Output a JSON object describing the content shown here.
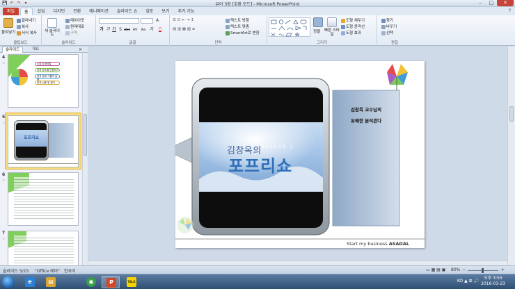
{
  "window": {
    "title": "유아 3장 [호환 모드] - Microsoft PowerPoint",
    "qat": [
      "💾",
      "↶",
      "↷",
      "▾"
    ]
  },
  "tabs": [
    "파일",
    "홈",
    "삽입",
    "디자인",
    "전환",
    "애니메이션",
    "슬라이드 쇼",
    "검토",
    "보기",
    "추가 기능"
  ],
  "help_icon": "?",
  "ribbon": {
    "clipboard": {
      "paste": "붙여넣기",
      "cut": "잘라내기",
      "copy": "복사",
      "format_painter": "서식 복사",
      "name": "클립보드"
    },
    "slides": {
      "new": "새 슬라이드",
      "layout": "레이아웃",
      "reset": "원래대로",
      "section": "구역",
      "name": "슬라이드"
    },
    "font": {
      "name": "글꼴",
      "buttons": [
        "가",
        "가",
        "가",
        "가̲",
        "S",
        "abc",
        "AV",
        "Aa",
        "가",
        "A"
      ]
    },
    "paragraph": {
      "name": "단락",
      "text_dir": "텍스트 방향",
      "align_text": "텍스트 맞춤",
      "smartart": "SmartArt로 변환"
    },
    "drawing": {
      "name": "그리기",
      "arrange": "정렬",
      "quick_styles": "빠른 스타일",
      "fill": "도형 채우기",
      "outline": "도형 윤곽선",
      "effects": "도형 효과"
    },
    "editing": {
      "name": "편집",
      "find": "찾기",
      "replace": "바꾸기",
      "select": "선택"
    }
  },
  "panel": {
    "tab_slides": "슬라이드",
    "tab_outline": "개요",
    "close": "×",
    "slides": [
      {
        "num": "4",
        "star": "☆",
        "items": [
          "스피치 정리법",
          "장과 장소별 반응하기",
          "장과 문제 그룹의 설명",
          "장과 심층 및 평가"
        ]
      },
      {
        "num": "5",
        "star": "☆",
        "logo_small": "포프리쇼"
      },
      {
        "num": "6",
        "star": "☆"
      },
      {
        "num": "7",
        "star": "☆"
      }
    ]
  },
  "slide": {
    "logo_name": "김창옥의",
    "logo_title": "포프리쇼",
    "logo_season": "SEASON 2",
    "caption_line1": "김창옥 교수님의",
    "caption_line2": "유쾌한 분석관다",
    "footer_text": "Start my business",
    "footer_brand": "ASADAL"
  },
  "statusbar": {
    "slide_info": "슬라이드 5/15",
    "theme": "\"Office 테마\"",
    "language": "한국어",
    "zoom": "80%",
    "zoom_minus": "−",
    "zoom_plus": "+"
  },
  "taskbar": {
    "apps": [
      {
        "name": "ie",
        "glyph": "e",
        "color": "#2d7fd3"
      },
      {
        "name": "explorer",
        "glyph": "▤",
        "color": "#d9a631"
      },
      {
        "name": "chrome",
        "glyph": "◉",
        "color": "#3a9d4a"
      },
      {
        "name": "powerpoint",
        "glyph": "P",
        "color": "#d24726"
      },
      {
        "name": "kakaotalk",
        "glyph": "TALK",
        "color": "#f5d300"
      }
    ],
    "tray": "KO ▲ ⊞ 🔊",
    "time": "오후 3:55",
    "date": "2016-03-23"
  },
  "colors": {
    "file_tab": "#c8402f",
    "accent_blue": "#2f6fb8",
    "selection": "#f8dc7c"
  }
}
